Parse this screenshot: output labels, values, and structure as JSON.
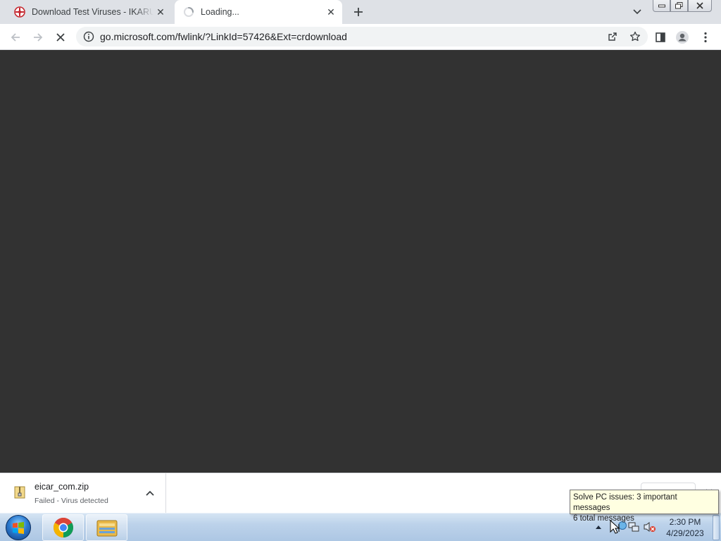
{
  "browser": {
    "tabs": [
      {
        "title": "Download Test Viruses - IKARUS",
        "active": false,
        "favicon": "ikarus-logo-icon"
      },
      {
        "title": "Loading...",
        "active": true,
        "favicon": "loading-spinner-icon"
      }
    ],
    "new_tab_icon": "plus-icon",
    "tab_search_icon": "chevron-down-icon",
    "window_controls": [
      "minimize-icon",
      "restore-icon",
      "close-icon"
    ],
    "toolbar": {
      "back_icon": "arrow-left-icon",
      "forward_icon": "arrow-right-icon",
      "stop_icon": "stop-x-icon",
      "url": "go.microsoft.com/fwlink/?LinkId=57426&Ext=crdownload",
      "site_info_icon": "info-icon",
      "share_icon": "share-icon",
      "bookmark_icon": "star-icon",
      "side_panel_icon": "side-panel-icon",
      "profile_icon": "person-icon",
      "menu_icon": "kebab-menu-icon"
    },
    "content_background": "#323232"
  },
  "download_shelf": {
    "item": {
      "filename": "eicar_com.zip",
      "status": "Failed - Virus detected",
      "icon": "zip-file-icon"
    },
    "show_all_label": "",
    "close_icon": "close-icon"
  },
  "tooltip": {
    "line1": "Solve PC issues: 3 important messages",
    "line2": "6 total messages"
  },
  "taskbar": {
    "start_icon": "windows-logo-icon",
    "apps": [
      "chrome-icon",
      "file-explorer-icon"
    ],
    "tray": [
      "show-hidden-icons-arrow",
      "action-center-flag-icon",
      "network-icon",
      "volume-muted-icon"
    ],
    "time": "2:30 PM",
    "date": "4/29/2023"
  },
  "colors": {
    "tabstrip": "#dee1e6",
    "page": "#323232",
    "tooltip_bg": "#ffffe1",
    "taskbar": "#bcd2ea"
  }
}
